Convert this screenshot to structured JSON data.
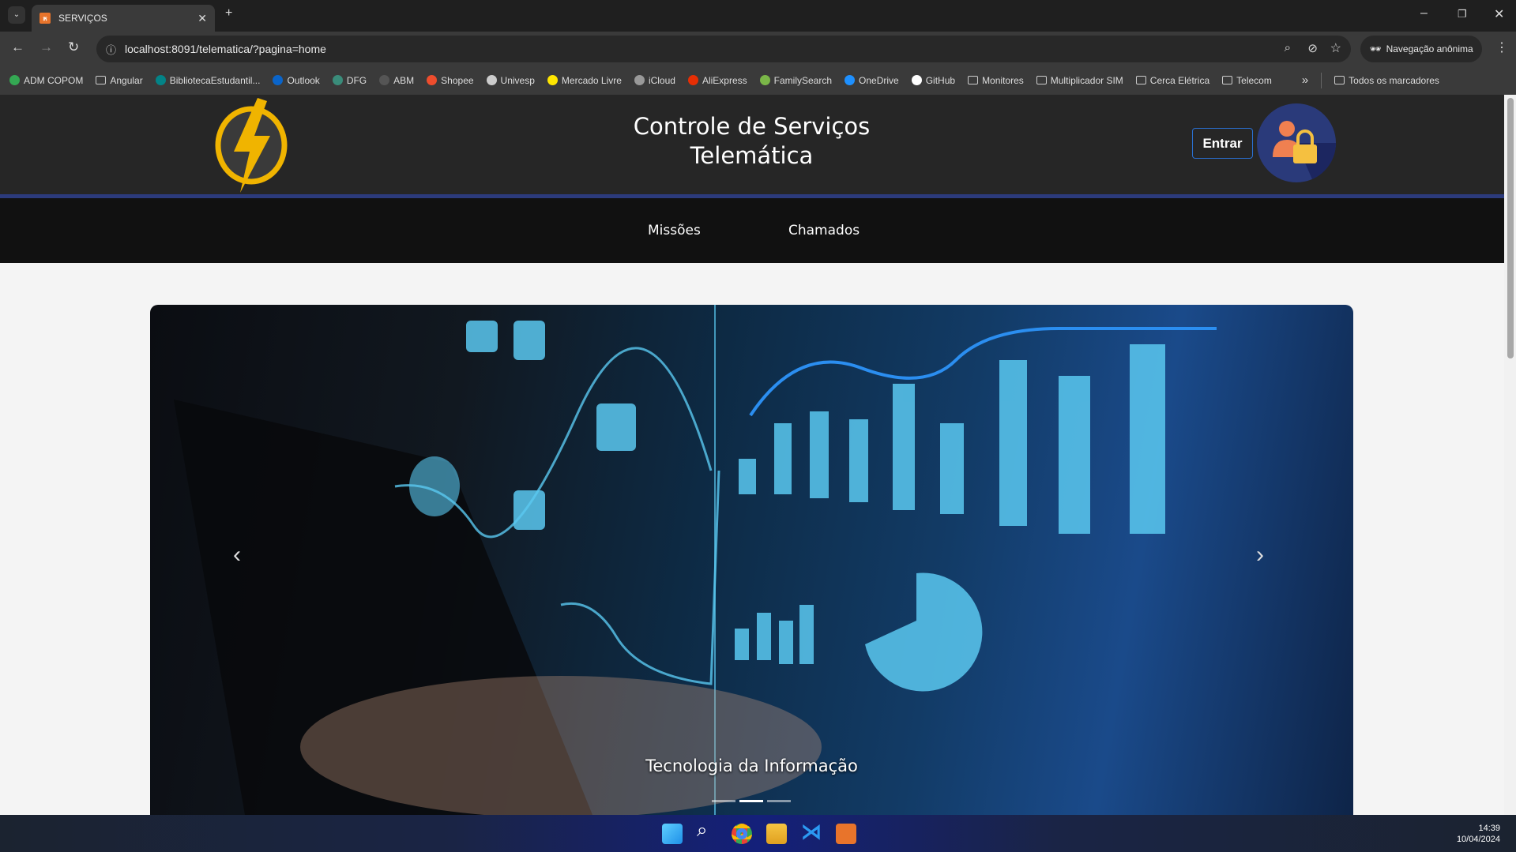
{
  "browser": {
    "tab_title": "SERVIÇOS",
    "url": "localhost:8091/telematica/?pagina=home",
    "incognito_label": "Navegação anônima",
    "bookmarks": [
      {
        "label": "ADM COPOM",
        "icon": "drive-icon",
        "color": "#34a853"
      },
      {
        "label": "Angular",
        "icon": "folder-icon"
      },
      {
        "label": "BibliotecaEstudantil...",
        "icon": "sharepoint-icon",
        "color": "#038387"
      },
      {
        "label": "Outlook",
        "icon": "outlook-icon",
        "color": "#0a64c9"
      },
      {
        "label": "DFG",
        "icon": "dfg-icon",
        "color": "#3a8c7a"
      },
      {
        "label": "ABM",
        "icon": "abm-icon",
        "color": "#555555"
      },
      {
        "label": "Shopee",
        "icon": "shopee-icon",
        "color": "#ee4d2d"
      },
      {
        "label": "Univesp",
        "icon": "globe-icon",
        "color": "#cccccc"
      },
      {
        "label": "Mercado Livre",
        "icon": "mercadolivre-icon",
        "color": "#ffe600"
      },
      {
        "label": "iCloud",
        "icon": "apple-icon",
        "color": "#999999"
      },
      {
        "label": "AliExpress",
        "icon": "aliexpress-icon",
        "color": "#e62e04"
      },
      {
        "label": "FamilySearch",
        "icon": "tree-icon",
        "color": "#7ab648"
      },
      {
        "label": "OneDrive",
        "icon": "cloud-icon",
        "color": "#1e90ff"
      },
      {
        "label": "GitHub",
        "icon": "github-icon",
        "color": "#ffffff"
      },
      {
        "label": "Monitores",
        "icon": "folder-icon"
      },
      {
        "label": "Multiplicador SIM",
        "icon": "folder-icon"
      },
      {
        "label": "Cerca Elétrica",
        "icon": "folder-icon"
      },
      {
        "label": "Telecom",
        "icon": "folder-icon"
      }
    ],
    "all_bookmarks": "Todos os marcadores"
  },
  "header": {
    "title_line1": "Controle de Serviços",
    "title_line2": "Telemática",
    "login_label": "Entrar"
  },
  "nav": {
    "items": [
      {
        "label": "Missões"
      },
      {
        "label": "Chamados"
      }
    ]
  },
  "carousel": {
    "caption": "Tecnologia da Informação",
    "slide_count": 3,
    "active_slide": 2
  },
  "taskbar": {
    "time": "14:39",
    "date": "10/04/2024"
  },
  "colors": {
    "accent_bar": "#2c3b7c",
    "logo_yellow": "#f0b400",
    "button_border": "#2a6fd0"
  }
}
